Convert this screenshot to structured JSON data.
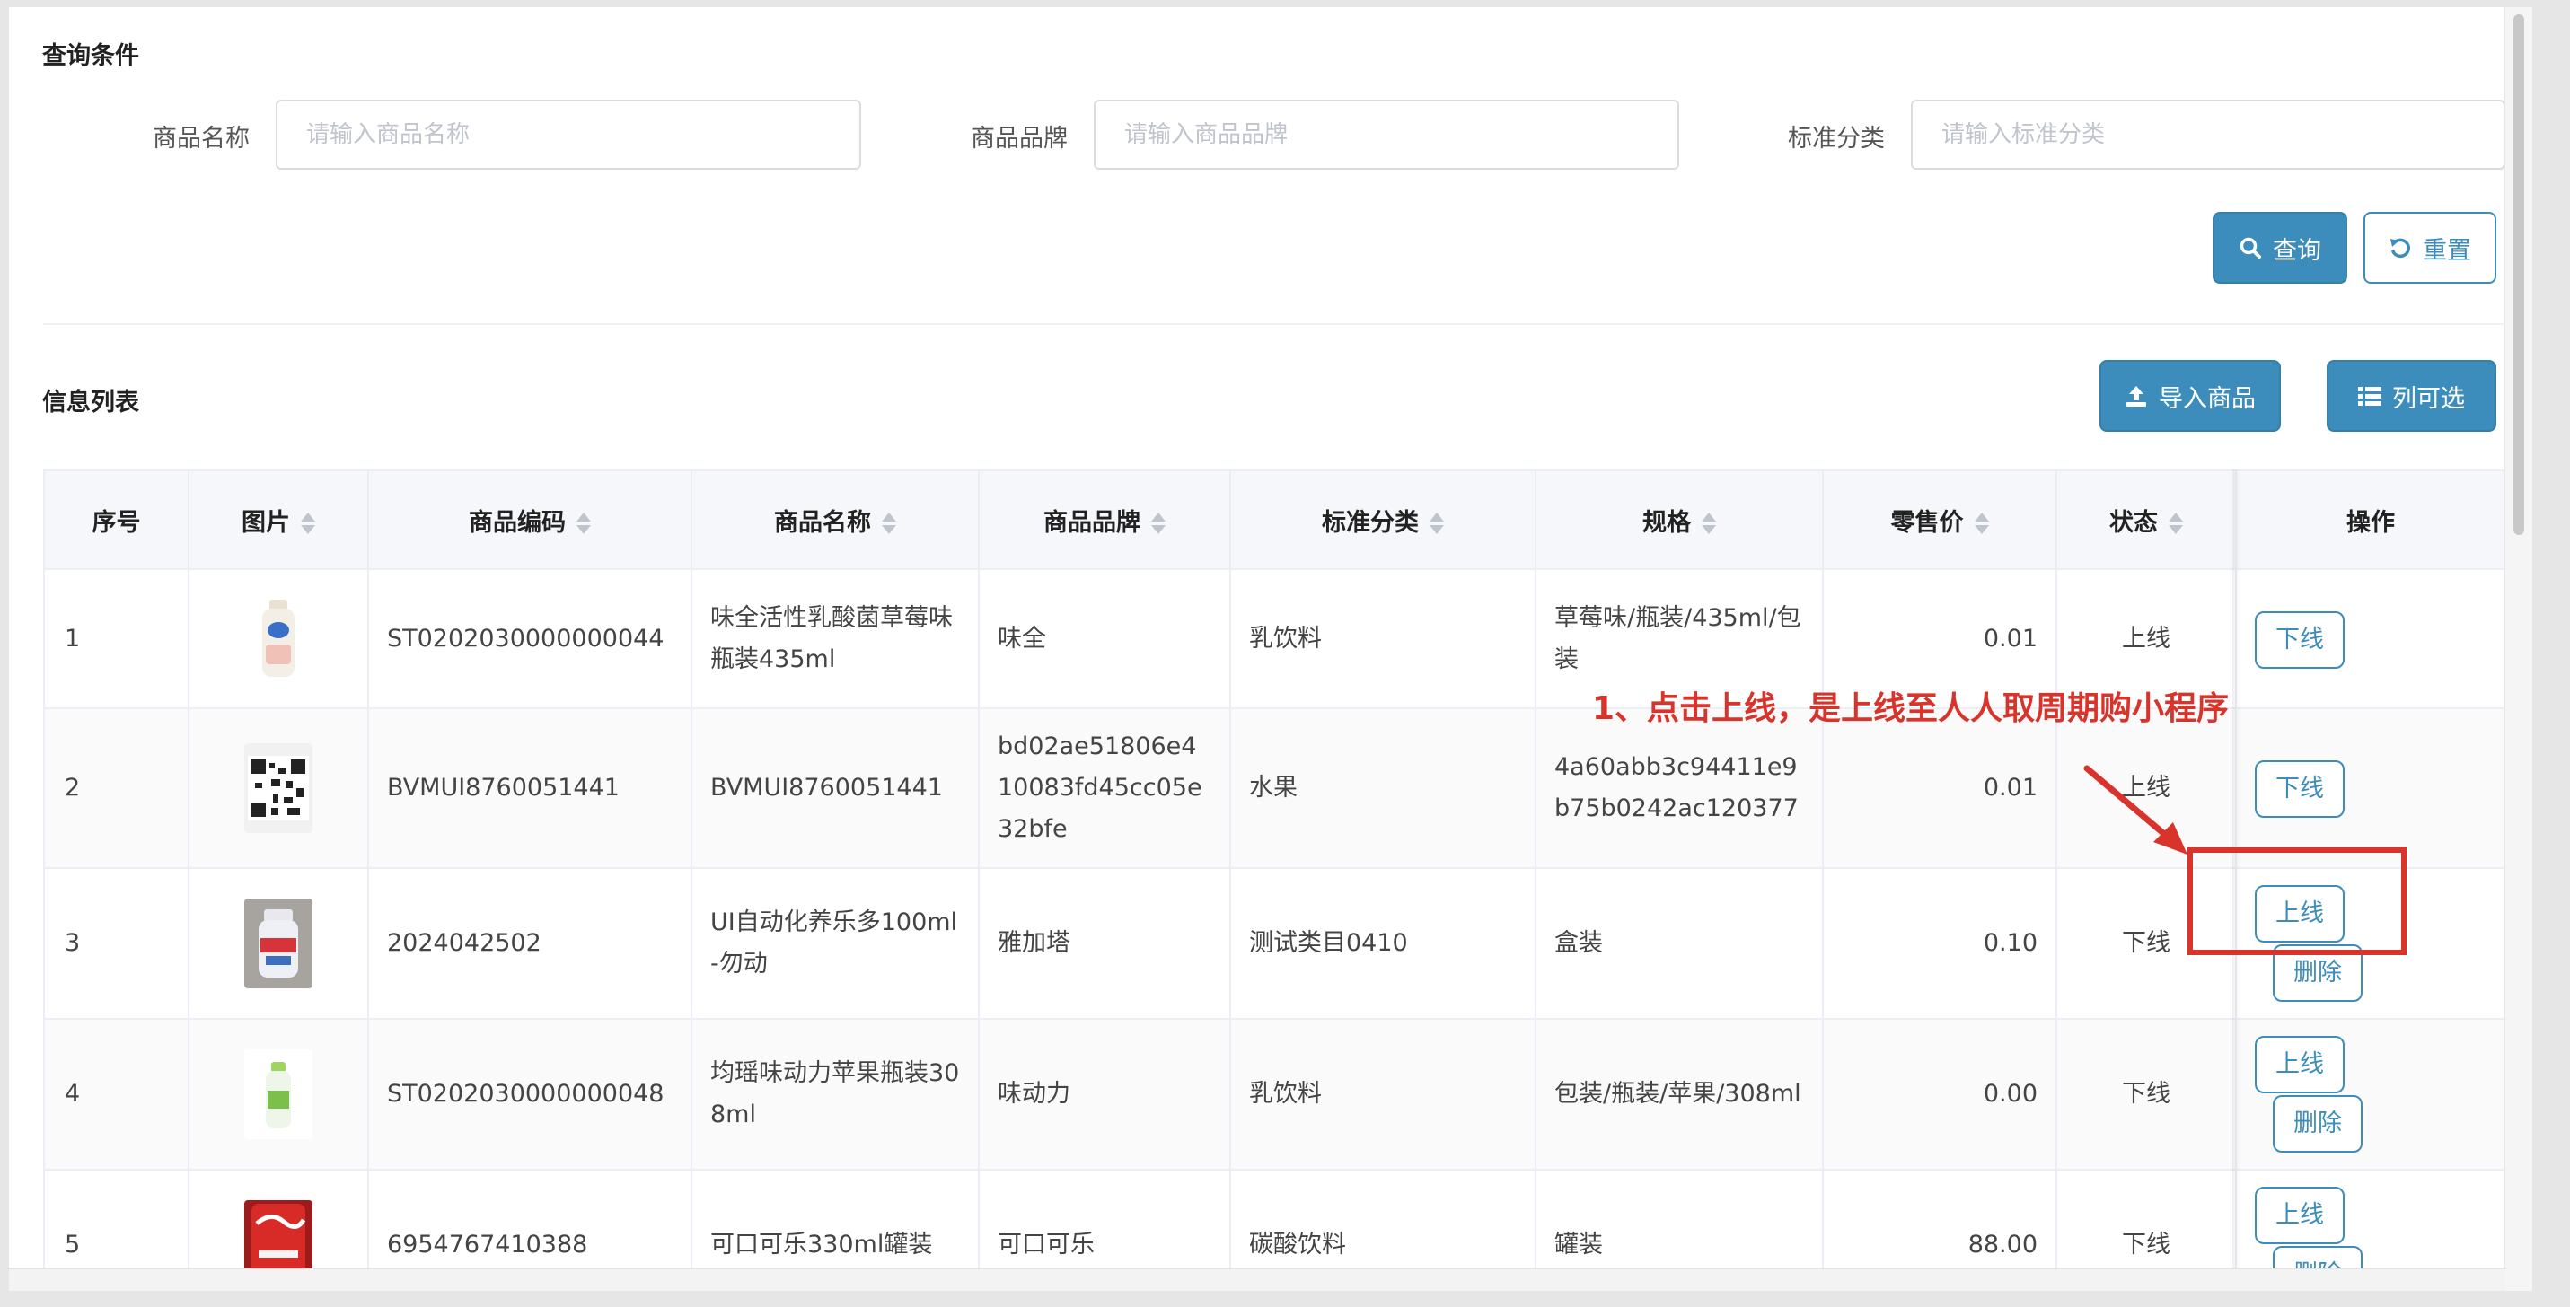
{
  "query": {
    "title": "查询条件",
    "fields": [
      {
        "label": "商品名称",
        "placeholder": "请输入商品名称",
        "value": ""
      },
      {
        "label": "商品品牌",
        "placeholder": "请输入商品品牌",
        "value": ""
      },
      {
        "label": "标准分类",
        "placeholder": "请输入标准分类",
        "value": ""
      }
    ],
    "search_label": "查询",
    "reset_label": "重置"
  },
  "list": {
    "title": "信息列表",
    "import_label": "导入商品",
    "columns_label": "列可选",
    "headers": [
      "序号",
      "图片",
      "商品编码",
      "商品名称",
      "商品品牌",
      "标准分类",
      "规格",
      "零售价",
      "状态",
      "操作"
    ],
    "rows": [
      {
        "seq": "1",
        "image": "milk-bottle",
        "code": "ST0202030000000044",
        "name": "味全活性乳酸菌草莓味瓶装435ml",
        "brand": "味全",
        "category": "乳饮料",
        "spec": "草莓味/瓶装/435ml/包装",
        "price": "0.01",
        "status": "上线",
        "actions": [
          "下线"
        ]
      },
      {
        "seq": "2",
        "image": "qr-code",
        "code": "BVMUI8760051441",
        "name": "BVMUI8760051441",
        "brand": "bd02ae51806e410083fd45cc05e32bfe",
        "category": "水果",
        "spec": "4a60abb3c94411e9b75b0242ac120377",
        "price": "0.01",
        "status": "上线",
        "actions": [
          "下线"
        ]
      },
      {
        "seq": "3",
        "image": "yakult-bottle",
        "code": "2024042502",
        "name": "UI自动化养乐多100ml-勿动",
        "brand": "雅加塔",
        "category": "测试类目0410",
        "spec": "盒装",
        "price": "0.10",
        "status": "下线",
        "actions": [
          "上线",
          "删除"
        ]
      },
      {
        "seq": "4",
        "image": "green-bottle",
        "code": "ST0202030000000048",
        "name": "均瑶味动力苹果瓶装308ml",
        "brand": "味动力",
        "category": "乳饮料",
        "spec": "包装/瓶装/苹果/308ml",
        "price": "0.00",
        "status": "下线",
        "actions": [
          "上线",
          "删除"
        ]
      },
      {
        "seq": "5",
        "image": "coke-can",
        "code": "6954767410388",
        "name": "可口可乐330ml罐装",
        "brand": "可口可乐",
        "category": "碳酸饮料",
        "spec": "罐装",
        "price": "88.00",
        "status": "下线",
        "actions": [
          "上线",
          "删除"
        ]
      }
    ]
  },
  "annotation": {
    "text": "1、点击上线，是上线至人人取周期购小程序",
    "color": "#d8342c"
  },
  "colors": {
    "primary": "#3c8dbc",
    "annotation": "#d8342c"
  }
}
